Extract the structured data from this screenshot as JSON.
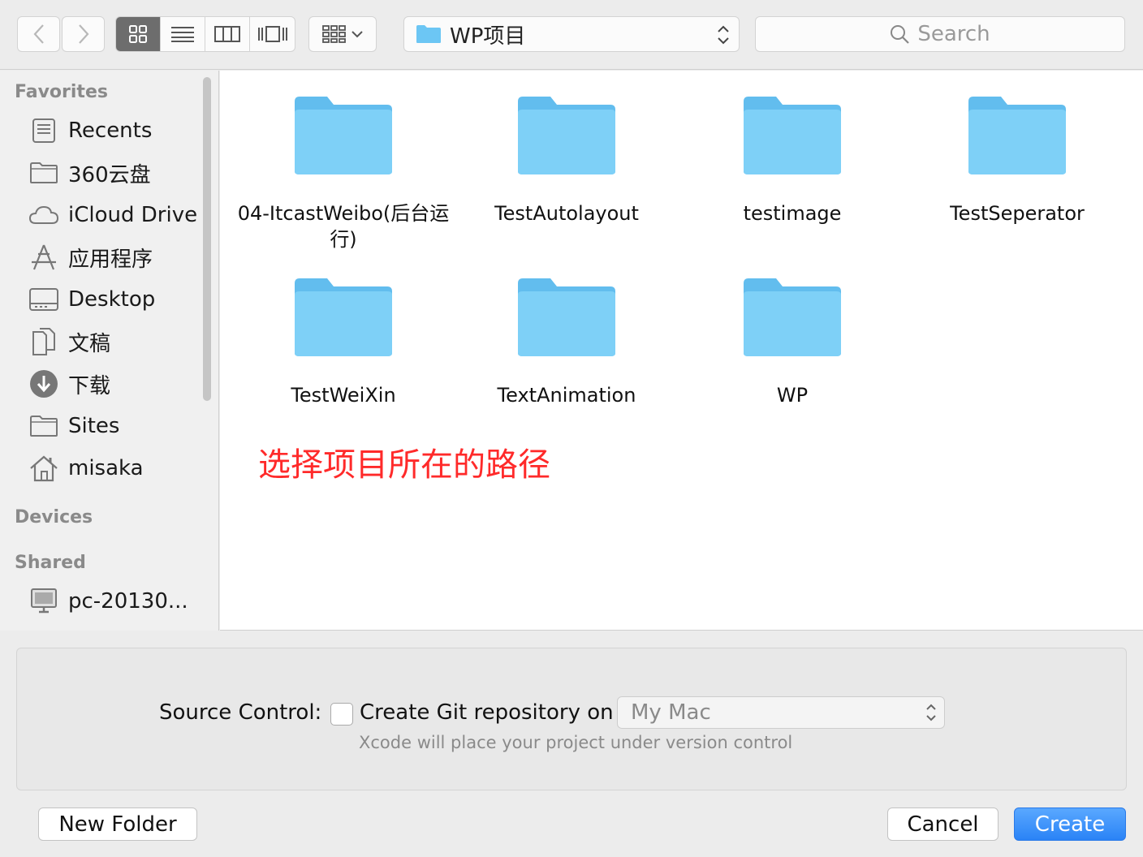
{
  "toolbar": {
    "back_icon": "chevron-left-icon",
    "forward_icon": "chevron-right-icon",
    "view_modes": [
      "icon-view",
      "list-view",
      "column-view",
      "cover-flow-view"
    ],
    "path_folder": "WP项目",
    "search_placeholder": "Search"
  },
  "sidebar": {
    "favorites_header": "Favorites",
    "favorites": [
      {
        "label": "Recents",
        "icon": "recents-icon"
      },
      {
        "label": "360云盘",
        "icon": "folder-icon"
      },
      {
        "label": "iCloud Drive",
        "icon": "cloud-icon"
      },
      {
        "label": "应用程序",
        "icon": "applications-icon"
      },
      {
        "label": "Desktop",
        "icon": "desktop-icon"
      },
      {
        "label": "文稿",
        "icon": "documents-icon"
      },
      {
        "label": "下载",
        "icon": "downloads-icon"
      },
      {
        "label": "Sites",
        "icon": "folder-icon"
      },
      {
        "label": "misaka",
        "icon": "home-icon"
      }
    ],
    "devices_header": "Devices",
    "shared_header": "Shared",
    "shared": [
      {
        "label": "pc-20130...",
        "icon": "computer-icon"
      }
    ]
  },
  "files": [
    {
      "name": "04-ItcastWeibo(后台运行)"
    },
    {
      "name": "TestAutolayout"
    },
    {
      "name": "testimage"
    },
    {
      "name": "TestSeperator"
    },
    {
      "name": "TestWeiXin"
    },
    {
      "name": "TextAnimation"
    },
    {
      "name": "WP"
    }
  ],
  "annotation": "选择项目所在的路径",
  "accessory": {
    "source_control_label": "Source Control:",
    "checkbox_checked": false,
    "git_label": "Create Git repository on",
    "location_value": "My Mac",
    "hint": "Xcode will place your project under version control"
  },
  "buttons": {
    "new_folder": "New Folder",
    "cancel": "Cancel",
    "create": "Create"
  },
  "colors": {
    "accent": "#2a83f6",
    "folder": "#6cc6f4",
    "annotation": "#ff2a2a"
  }
}
